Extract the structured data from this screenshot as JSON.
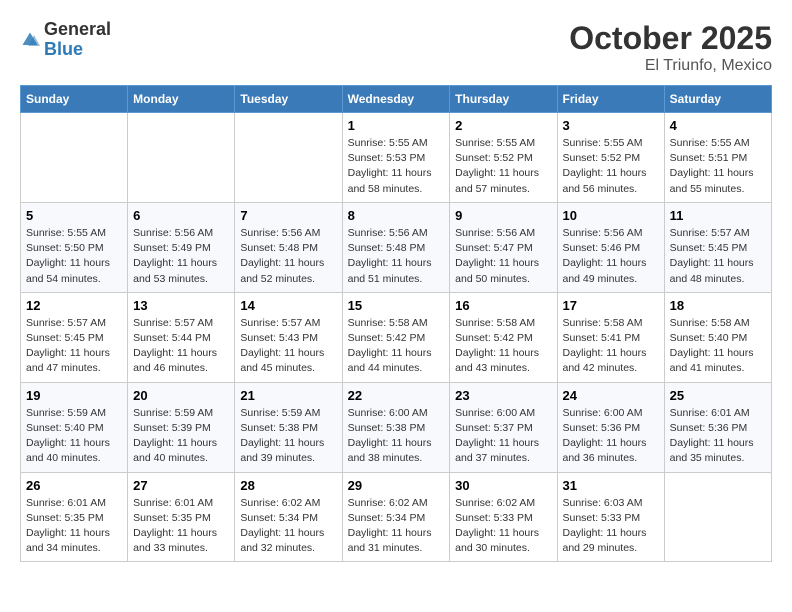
{
  "header": {
    "logo": {
      "general": "General",
      "blue": "Blue"
    },
    "month": "October 2025",
    "location": "El Triunfo, Mexico"
  },
  "weekdays": [
    "Sunday",
    "Monday",
    "Tuesday",
    "Wednesday",
    "Thursday",
    "Friday",
    "Saturday"
  ],
  "weeks": [
    [
      {
        "day": "",
        "info": ""
      },
      {
        "day": "",
        "info": ""
      },
      {
        "day": "",
        "info": ""
      },
      {
        "day": "1",
        "info": "Sunrise: 5:55 AM\nSunset: 5:53 PM\nDaylight: 11 hours and 58 minutes."
      },
      {
        "day": "2",
        "info": "Sunrise: 5:55 AM\nSunset: 5:52 PM\nDaylight: 11 hours and 57 minutes."
      },
      {
        "day": "3",
        "info": "Sunrise: 5:55 AM\nSunset: 5:52 PM\nDaylight: 11 hours and 56 minutes."
      },
      {
        "day": "4",
        "info": "Sunrise: 5:55 AM\nSunset: 5:51 PM\nDaylight: 11 hours and 55 minutes."
      }
    ],
    [
      {
        "day": "5",
        "info": "Sunrise: 5:55 AM\nSunset: 5:50 PM\nDaylight: 11 hours and 54 minutes."
      },
      {
        "day": "6",
        "info": "Sunrise: 5:56 AM\nSunset: 5:49 PM\nDaylight: 11 hours and 53 minutes."
      },
      {
        "day": "7",
        "info": "Sunrise: 5:56 AM\nSunset: 5:48 PM\nDaylight: 11 hours and 52 minutes."
      },
      {
        "day": "8",
        "info": "Sunrise: 5:56 AM\nSunset: 5:48 PM\nDaylight: 11 hours and 51 minutes."
      },
      {
        "day": "9",
        "info": "Sunrise: 5:56 AM\nSunset: 5:47 PM\nDaylight: 11 hours and 50 minutes."
      },
      {
        "day": "10",
        "info": "Sunrise: 5:56 AM\nSunset: 5:46 PM\nDaylight: 11 hours and 49 minutes."
      },
      {
        "day": "11",
        "info": "Sunrise: 5:57 AM\nSunset: 5:45 PM\nDaylight: 11 hours and 48 minutes."
      }
    ],
    [
      {
        "day": "12",
        "info": "Sunrise: 5:57 AM\nSunset: 5:45 PM\nDaylight: 11 hours and 47 minutes."
      },
      {
        "day": "13",
        "info": "Sunrise: 5:57 AM\nSunset: 5:44 PM\nDaylight: 11 hours and 46 minutes."
      },
      {
        "day": "14",
        "info": "Sunrise: 5:57 AM\nSunset: 5:43 PM\nDaylight: 11 hours and 45 minutes."
      },
      {
        "day": "15",
        "info": "Sunrise: 5:58 AM\nSunset: 5:42 PM\nDaylight: 11 hours and 44 minutes."
      },
      {
        "day": "16",
        "info": "Sunrise: 5:58 AM\nSunset: 5:42 PM\nDaylight: 11 hours and 43 minutes."
      },
      {
        "day": "17",
        "info": "Sunrise: 5:58 AM\nSunset: 5:41 PM\nDaylight: 11 hours and 42 minutes."
      },
      {
        "day": "18",
        "info": "Sunrise: 5:58 AM\nSunset: 5:40 PM\nDaylight: 11 hours and 41 minutes."
      }
    ],
    [
      {
        "day": "19",
        "info": "Sunrise: 5:59 AM\nSunset: 5:40 PM\nDaylight: 11 hours and 40 minutes."
      },
      {
        "day": "20",
        "info": "Sunrise: 5:59 AM\nSunset: 5:39 PM\nDaylight: 11 hours and 40 minutes."
      },
      {
        "day": "21",
        "info": "Sunrise: 5:59 AM\nSunset: 5:38 PM\nDaylight: 11 hours and 39 minutes."
      },
      {
        "day": "22",
        "info": "Sunrise: 6:00 AM\nSunset: 5:38 PM\nDaylight: 11 hours and 38 minutes."
      },
      {
        "day": "23",
        "info": "Sunrise: 6:00 AM\nSunset: 5:37 PM\nDaylight: 11 hours and 37 minutes."
      },
      {
        "day": "24",
        "info": "Sunrise: 6:00 AM\nSunset: 5:36 PM\nDaylight: 11 hours and 36 minutes."
      },
      {
        "day": "25",
        "info": "Sunrise: 6:01 AM\nSunset: 5:36 PM\nDaylight: 11 hours and 35 minutes."
      }
    ],
    [
      {
        "day": "26",
        "info": "Sunrise: 6:01 AM\nSunset: 5:35 PM\nDaylight: 11 hours and 34 minutes."
      },
      {
        "day": "27",
        "info": "Sunrise: 6:01 AM\nSunset: 5:35 PM\nDaylight: 11 hours and 33 minutes."
      },
      {
        "day": "28",
        "info": "Sunrise: 6:02 AM\nSunset: 5:34 PM\nDaylight: 11 hours and 32 minutes."
      },
      {
        "day": "29",
        "info": "Sunrise: 6:02 AM\nSunset: 5:34 PM\nDaylight: 11 hours and 31 minutes."
      },
      {
        "day": "30",
        "info": "Sunrise: 6:02 AM\nSunset: 5:33 PM\nDaylight: 11 hours and 30 minutes."
      },
      {
        "day": "31",
        "info": "Sunrise: 6:03 AM\nSunset: 5:33 PM\nDaylight: 11 hours and 29 minutes."
      },
      {
        "day": "",
        "info": ""
      }
    ]
  ]
}
